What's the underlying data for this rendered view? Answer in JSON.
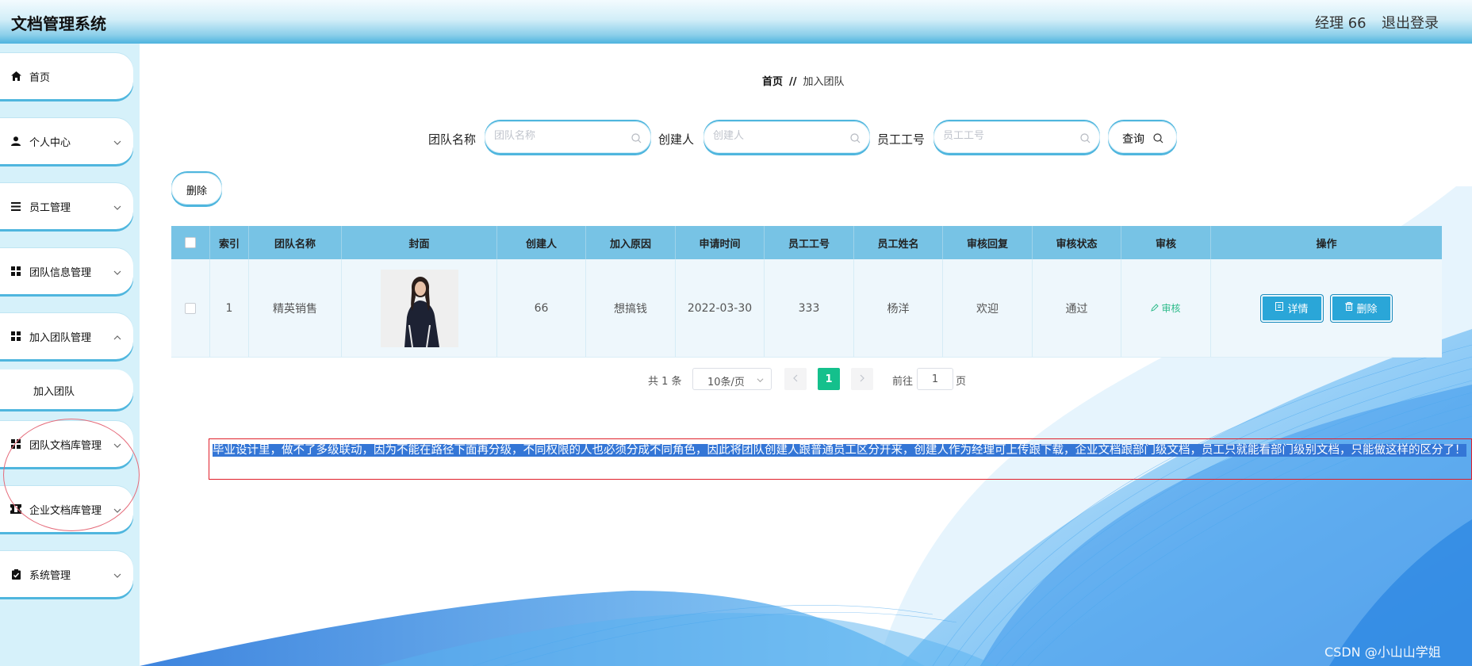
{
  "header": {
    "title": "文档管理系统",
    "user": "经理 66",
    "logout": "退出登录"
  },
  "sidebar": {
    "items": [
      {
        "label": "首页",
        "icon": "home-icon"
      },
      {
        "label": "个人中心",
        "icon": "person-icon"
      },
      {
        "label": "员工管理",
        "icon": "list-icon"
      },
      {
        "label": "团队信息管理",
        "icon": "grid-icon"
      },
      {
        "label": "加入团队管理",
        "icon": "grid-icon"
      },
      {
        "label": "团队文档库管理",
        "icon": "grid-icon"
      },
      {
        "label": "企业文档库管理",
        "icon": "ticket-icon"
      },
      {
        "label": "系统管理",
        "icon": "clipboard-icon"
      }
    ],
    "sub_item": "加入团队"
  },
  "breadcrumb": {
    "home": "首页",
    "separator": "//",
    "current": "加入团队"
  },
  "search": {
    "team_name_label": "团队名称",
    "team_name_placeholder": "团队名称",
    "creator_label": "创建人",
    "creator_placeholder": "创建人",
    "employee_no_label": "员工工号",
    "employee_no_placeholder": "员工工号",
    "query_label": "查询"
  },
  "toolbar": {
    "delete_label": "删除"
  },
  "table": {
    "headers": [
      "索引",
      "团队名称",
      "封面",
      "创建人",
      "加入原因",
      "申请时间",
      "员工工号",
      "员工姓名",
      "审核回复",
      "审核状态",
      "审核",
      "操作"
    ],
    "rows": [
      {
        "index": "1",
        "team_name": "精英销售",
        "creator": "66",
        "reason": "想搞钱",
        "apply_time": "2022-03-30",
        "employee_no": "333",
        "employee_name": "杨洋",
        "reply": "欢迎",
        "status": "通过",
        "audit": "审核",
        "detail_btn": "详情",
        "delete_btn": "删除"
      }
    ]
  },
  "pagination": {
    "total": "共 1 条",
    "page_size": "10条/页",
    "current_page": "1",
    "goto_label": "前往",
    "goto_value": "1",
    "page_suffix": "页"
  },
  "note": "毕业设计里，做不了多级联动，因为不能在路径下面再分级，不同权限的人也必须分成不同角色，因此将团队创建人跟普通员工区分开来，创建人作为经理可上传跟下载，企业文档跟部门级文档，员工只就能看部门级别文档，只能做这样的区分了！",
  "watermark": "CSDN @小山山学姐",
  "colors": {
    "header_gradient_end": "#4eb3df",
    "sidebar_bg": "#d6f1fa",
    "table_header": "#77c3e5",
    "accent_button": "#2aa6d8",
    "pager_active": "#14c08c",
    "note_border": "#e0202a",
    "note_highlight": "#3476d6"
  }
}
